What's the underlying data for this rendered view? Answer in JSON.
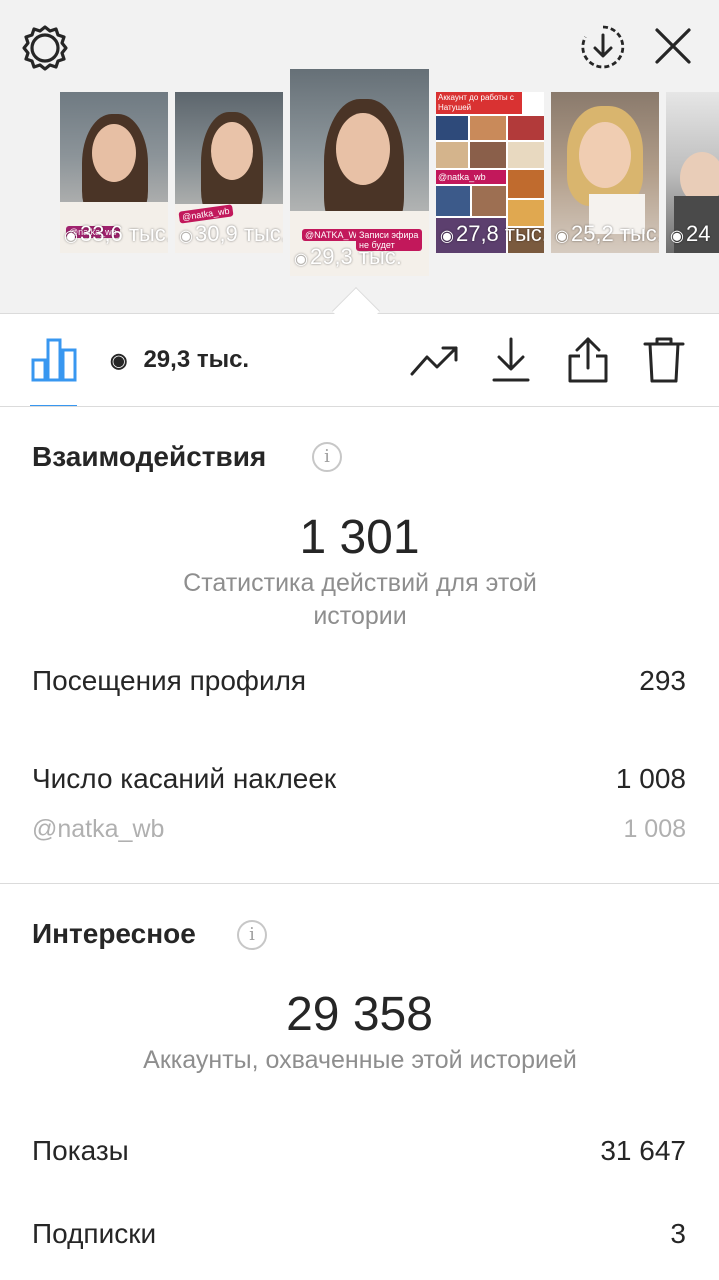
{
  "header": {
    "settings_icon": "gear-icon",
    "download_icon": "download-circle-icon",
    "close_icon": "close-icon"
  },
  "stories": [
    {
      "views": "33,6 тыс.",
      "sticker": "@natka_wb",
      "sticker_color": "#a0226e"
    },
    {
      "views": "30,9 тыс.",
      "sticker": "@natka_wb",
      "sticker_color": "#c2185b"
    },
    {
      "views": "29,3 тыс.",
      "sticker": "@NATKA_WB",
      "sticker2": "Записи эфира не будет",
      "sticker_color": "#c2185b",
      "selected": true
    },
    {
      "views": "27,8 тыс.",
      "title": "Аккаунт до работы с Натушей",
      "tag": "@natka_wb"
    },
    {
      "views": "25,2 тыс."
    },
    {
      "views": "24"
    }
  ],
  "action_bar": {
    "views": "29,3 тыс.",
    "insights_icon": "bar-chart-icon",
    "eye_icon": "eye-icon",
    "promote_icon": "trending-up-icon",
    "save_icon": "download-icon",
    "share_icon": "share-icon",
    "delete_icon": "trash-icon"
  },
  "interactions": {
    "title": "Взаимодействия",
    "total": "1 301",
    "description": "Статистика действий для этой истории",
    "rows": [
      {
        "label": "Посещения профиля",
        "value": "293"
      },
      {
        "label": "Число касаний наклеек",
        "value": "1 008"
      },
      {
        "label": "@natka_wb",
        "value": "1 008"
      }
    ]
  },
  "discovery": {
    "title": "Интересное",
    "total": "29 358",
    "description": "Аккаунты, охваченные этой историей",
    "rows": [
      {
        "label": "Показы",
        "value": "31 647"
      },
      {
        "label": "Подписки",
        "value": "3"
      }
    ]
  },
  "colors": {
    "accent": "#3897f0",
    "text": "#262626",
    "muted": "#8e8e8e",
    "tray_bg": "#f2f2f2"
  }
}
